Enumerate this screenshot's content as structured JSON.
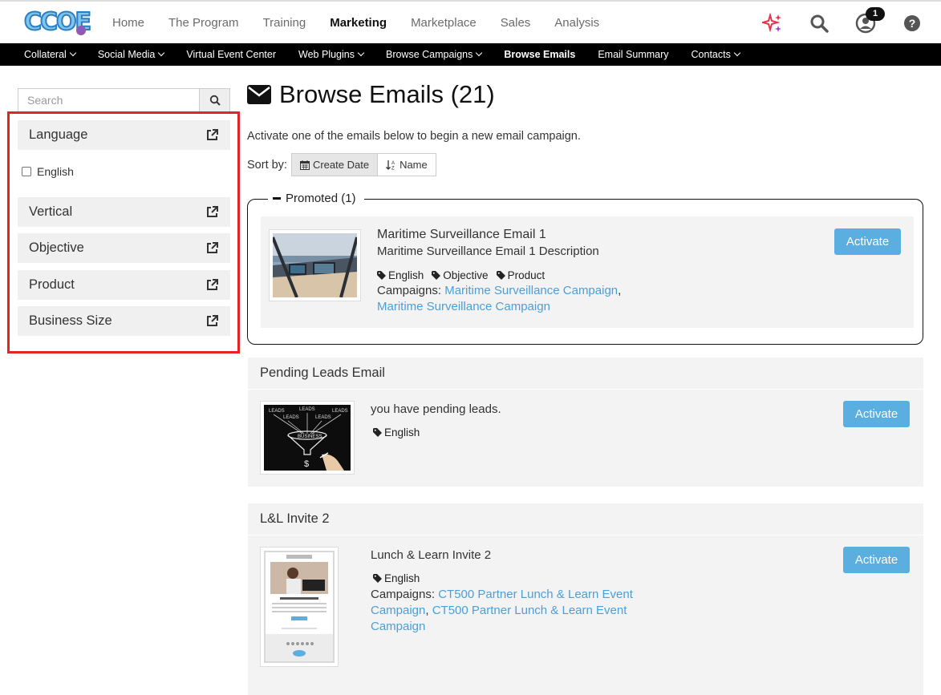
{
  "brand": {
    "logo_text": "CCOE",
    "accent": "#5aaee0",
    "highlight": "#e42323"
  },
  "topnav": {
    "items": [
      {
        "label": "Home"
      },
      {
        "label": "The Program"
      },
      {
        "label": "Training"
      },
      {
        "label": "Marketing",
        "active": true
      },
      {
        "label": "Marketplace"
      },
      {
        "label": "Sales"
      },
      {
        "label": "Analysis"
      }
    ],
    "notification_count": "1",
    "icons": [
      "sparkle-icon",
      "search-icon",
      "user-icon",
      "help-icon"
    ]
  },
  "subnav": {
    "items": [
      {
        "label": "Collateral",
        "caret": true
      },
      {
        "label": "Social Media",
        "caret": true
      },
      {
        "label": "Virtual Event Center",
        "caret": false
      },
      {
        "label": "Web Plugins",
        "caret": true
      },
      {
        "label": "Browse Campaigns",
        "caret": true
      },
      {
        "label": "Browse Emails",
        "caret": false,
        "active": true
      },
      {
        "label": "Email Summary",
        "caret": false
      },
      {
        "label": "Contacts",
        "caret": true
      }
    ]
  },
  "sidebar": {
    "search_placeholder": "Search",
    "filters": {
      "language": "Language",
      "vertical": "Vertical",
      "objective": "Objective",
      "product": "Product",
      "business_size": "Business Size"
    },
    "language_option": "English"
  },
  "main": {
    "title": "Browse Emails (21)",
    "intro": "Activate one of the emails below to begin a new email campaign.",
    "sort_label": "Sort by:",
    "sort_create_date": "Create Date",
    "sort_name": "Name",
    "promoted_label": "Promoted (1)",
    "activate_label": "Activate",
    "campaigns_label": "Campaigns:",
    "promoted_email": {
      "title": "Maritime Surveillance Email 1",
      "description": "Maritime Surveillance Email 1 Description",
      "tags": [
        "English",
        "Objective",
        "Product"
      ],
      "campaign_1": "Maritime Surveillance Campaign",
      "campaign_2": "Maritime Surveillance Campaign"
    },
    "email_2": {
      "heading": "Pending Leads Email",
      "description": "you have pending leads.",
      "tag": "English"
    },
    "email_3": {
      "heading": "L&L Invite 2",
      "description": "Lunch & Learn Invite 2",
      "tag": "English",
      "campaign_1": "CT500 Partner Lunch & Learn Event Campaign",
      "campaign_2": "CT500 Partner Lunch & Learn Event Campaign"
    }
  }
}
